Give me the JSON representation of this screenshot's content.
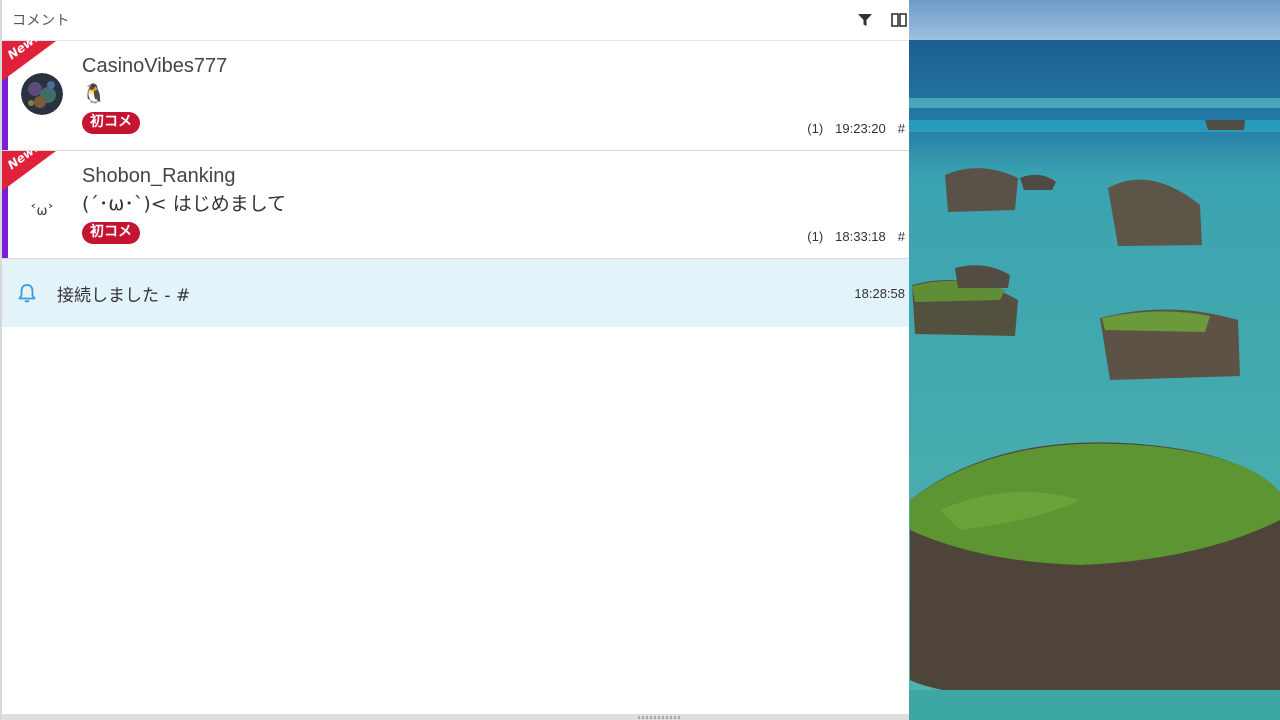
{
  "panel": {
    "title": "コメント",
    "icons": [
      "filter-icon",
      "columns-icon"
    ]
  },
  "comments": [
    {
      "ribbon": "New!",
      "username": "CasinoVibes777",
      "message": "🐧",
      "badge": "初コメ",
      "count": "(1)",
      "time": "19:23:20",
      "hash": "#"
    },
    {
      "ribbon": "New!",
      "avatar_text": "˂ω˃",
      "username": "Shobon_Ranking",
      "message": "(´･ω･`)< はじめまして",
      "badge": "初コメ",
      "count": "(1)",
      "time": "18:33:18",
      "hash": "#"
    }
  ],
  "system": {
    "icon": "bell-icon",
    "text": "接続しました - #",
    "time": "18:28:58"
  },
  "colors": {
    "accent": "#7a1fd9",
    "ribbon": "#e0213a",
    "badge": "#c41432",
    "system_bg": "#e2f3f9",
    "bell": "#3a9bd8"
  }
}
